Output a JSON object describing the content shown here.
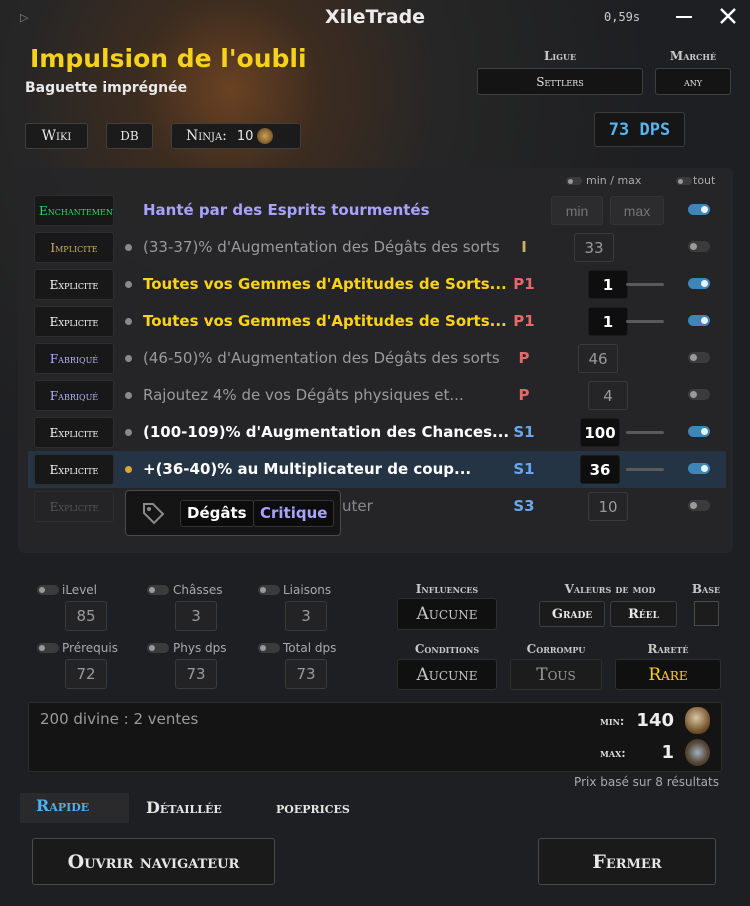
{
  "window": {
    "title": "XileTrade",
    "timer": "0,59s"
  },
  "item": {
    "name": "Impulsion de l'oubli",
    "base": "Baguette imprégnée"
  },
  "links": {
    "wiki": "Wiki",
    "db": "DB",
    "ninja_label": "Ninja:",
    "ninja_value": "10"
  },
  "league": {
    "label": "Ligue",
    "value": "Settlers"
  },
  "market": {
    "label": "Marché",
    "value": "any"
  },
  "dps": "73 DPS",
  "mods_header": {
    "minmax": "min / max",
    "all": "tout"
  },
  "mods": [
    {
      "type": "Enchantement",
      "text": "Hanté par des Esprits tourmentés",
      "tier": "",
      "value": "",
      "min_placeholder": "min",
      "max_placeholder": "max",
      "enabled": true
    },
    {
      "type": "Implicite",
      "text": "(33-37)% d'Augmentation des Dégâts des sorts",
      "tier": "I",
      "value": "33",
      "enabled": false
    },
    {
      "type": "Explicite",
      "text": "Toutes vos Gemmes d'Aptitudes de Sorts...",
      "tier": "P1",
      "value": "1",
      "enabled": true
    },
    {
      "type": "Explicite",
      "text": "Toutes vos Gemmes d'Aptitudes de Sorts...",
      "tier": "P1",
      "value": "1",
      "enabled": true
    },
    {
      "type": "Fabriqué",
      "text": "(46-50)% d'Augmentation des Dégâts des sorts",
      "tier": "P",
      "value": "46",
      "enabled": false
    },
    {
      "type": "Fabriqué",
      "text": "Rajoutez 4% de vos Dégâts physiques et...",
      "tier": "P",
      "value": "4",
      "enabled": false
    },
    {
      "type": "Explicite",
      "text": "(100-109)% d'Augmentation des Chances...",
      "tier": "S1",
      "value": "100",
      "enabled": true
    },
    {
      "type": "Explicite",
      "text": "+(36-40)% au Multiplicateur de coup...",
      "tier": "S1",
      "value": "36",
      "enabled": true
    },
    {
      "type": "Explicite",
      "text": "uter",
      "tier": "S3",
      "value": "10",
      "enabled": false
    }
  ],
  "tooltip": {
    "tags": [
      "Dégâts",
      "Critique"
    ]
  },
  "stats": [
    {
      "label": "iLevel",
      "value": "85"
    },
    {
      "label": "Châsses",
      "value": "3"
    },
    {
      "label": "Liaisons",
      "value": "3"
    },
    {
      "label": "Prérequis",
      "value": "72"
    },
    {
      "label": "Phys dps",
      "value": "73"
    },
    {
      "label": "Total dps",
      "value": "73"
    }
  ],
  "filters": {
    "influences": {
      "label": "Influences",
      "value": "Aucune"
    },
    "mod_values": {
      "label": "Valeurs de mod",
      "grade": "Grade",
      "real": "Réel"
    },
    "base": {
      "label": "Base"
    },
    "conditions": {
      "label": "Conditions",
      "value": "Aucune"
    },
    "corrupted": {
      "label": "Corrompu",
      "value": "Tous"
    },
    "rarity": {
      "label": "Rareté",
      "value": "Rare"
    }
  },
  "results": {
    "summary": "200 divine : 2 ventes",
    "min_label": "min:",
    "min_value": "140",
    "max_label": "max:",
    "max_value": "1",
    "footer": "Prix basé sur 8 résultats"
  },
  "tabs": [
    "Rapide",
    "Détaillée",
    "poeprices"
  ],
  "buttons": {
    "open": "Ouvrir navigateur",
    "close": "Fermer"
  },
  "colors": {
    "title": "#f6d11d",
    "enchant": "#a7a3ff",
    "unique_mod": "#ffd21a",
    "tier_prefix": "#e36a6a",
    "tier_suffix": "#6aa6ee",
    "accent": "#3f86b8",
    "dps": "#58b4f0"
  }
}
